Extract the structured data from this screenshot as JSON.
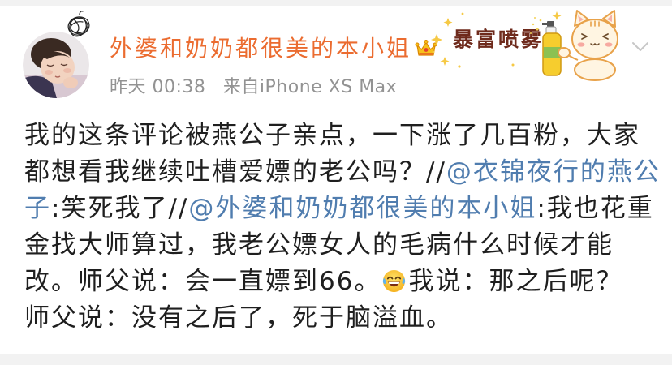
{
  "colors": {
    "background": "#ffffff",
    "divider": "#f2f2f2",
    "author_name": "#eb6c30",
    "meta_text": "#939393",
    "body_text": "#1f1f1f",
    "mention": "#507daf",
    "vip_crown": "#f6c21c",
    "menu_chevron": "#c7c7c7"
  },
  "post": {
    "author": {
      "name": "外婆和奶奶都很美的本小姐",
      "pendant_icon": "scribble-pendant-icon",
      "badge_icon": "vip-crown-icon"
    },
    "meta": {
      "time": "昨天 00:38",
      "source": "来自iPhone XS Max"
    },
    "card_decoration": {
      "text": "暴富喷雾",
      "icon": "cat-with-spray-bottle-icon"
    },
    "menu_icon": "chevron-down-icon",
    "body": {
      "lines": [
        [
          "我的这条评论被燕公子亲点，一下涨了几百粉，大家"
        ],
        [
          "都想看我继续吐槽爱嫖的老公吗？//",
          "@衣锦夜行的燕公"
        ],
        [
          "子",
          ":笑死我了//",
          "@外婆和奶奶都很美的本小姐",
          ":我也花重"
        ],
        [
          "金找大师算过，我老公嫖女人的毛病什么时候才能"
        ],
        [
          "改。师父说：会一直嫖到66。",
          "我说：那之后呢？"
        ],
        [
          "师父说：没有之后了，死于脑溢血。"
        ]
      ],
      "emoji_icon": "face-with-tears-of-joy-icon"
    }
  }
}
